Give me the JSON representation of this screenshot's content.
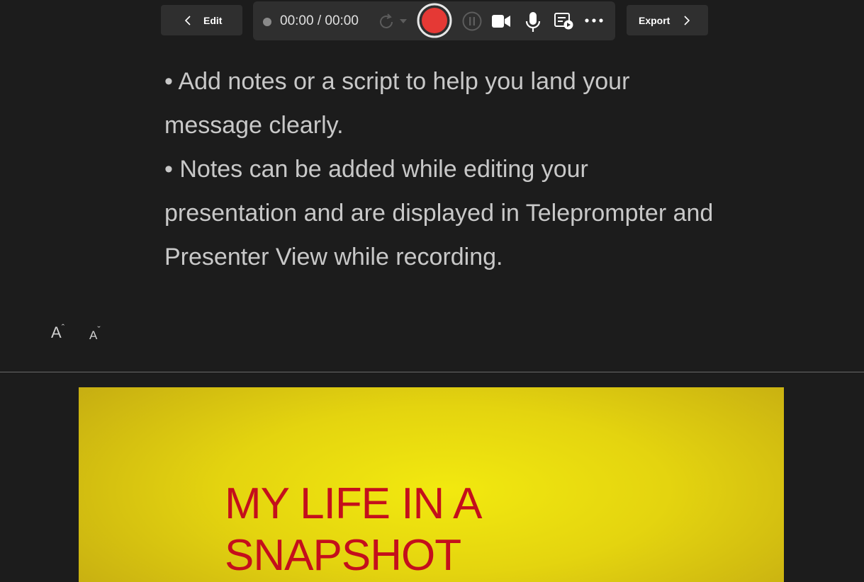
{
  "toolbar": {
    "edit_label": "Edit",
    "export_label": "Export",
    "timer": "00:00 / 00:00",
    "record_color": "#e53935"
  },
  "notes": {
    "line1": "• Add notes or a script to help you land your message clearly.",
    "line2": "• Notes can be added while editing your presentation and are displayed in Teleprompter and Presenter View while recording."
  },
  "font_controls": {
    "increase_label": "A",
    "decrease_label": "A"
  },
  "slide": {
    "title_line1": "MY LIFE IN A",
    "title_line2": "SNAPSHOT",
    "title_color": "#c40f1c",
    "background_color": "#e8db0f"
  },
  "icons": [
    "chevron-left-icon",
    "chevron-right-icon",
    "recording-dot-icon",
    "retake-icon",
    "dropdown-caret-icon",
    "record-icon",
    "pause-icon",
    "camera-icon",
    "microphone-icon",
    "teleprompter-icon",
    "more-options-icon",
    "font-increase-icon",
    "font-decrease-icon"
  ]
}
